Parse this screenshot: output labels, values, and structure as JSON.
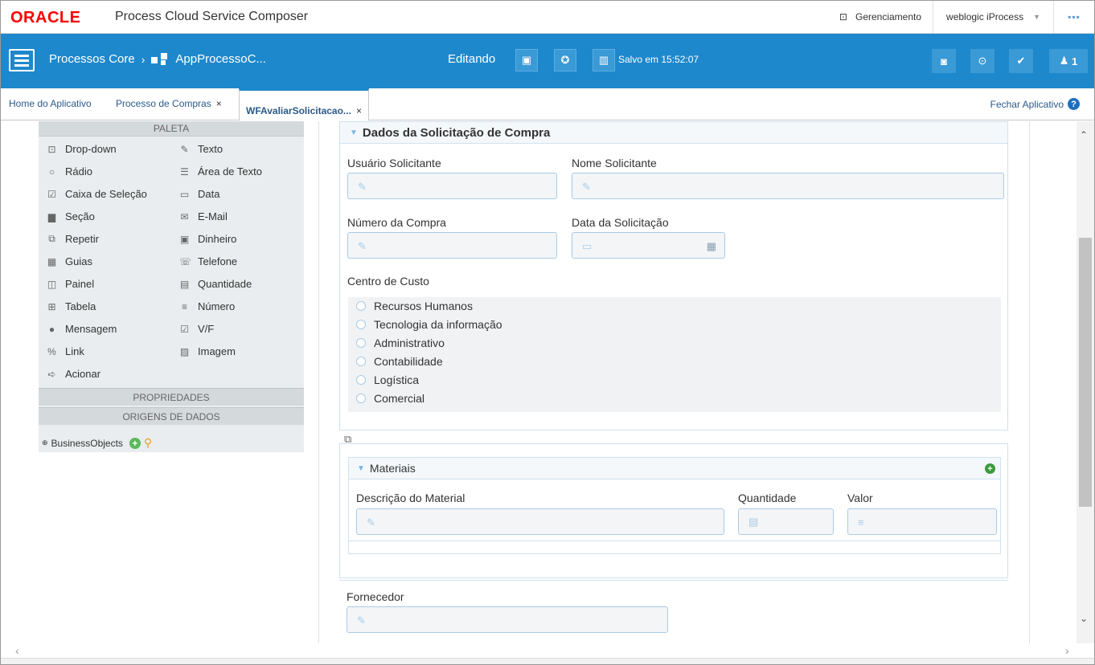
{
  "header": {
    "logo": "ORACLE",
    "app_name": "Process Cloud Service Composer",
    "management": "Gerenciamento",
    "user": "weblogic iProcess",
    "more": "..."
  },
  "toolbar": {
    "project": "Processos Core",
    "separator": "›",
    "app": "AppProcessoC...",
    "mode": "Editando",
    "saved": "Salvo em 15:52:07",
    "user_count": "1"
  },
  "tabs": [
    {
      "label": "Home do Aplicativo"
    },
    {
      "label": "Processo de Compras",
      "close": "×"
    },
    {
      "label": "WFAvaliarSolicitacao...",
      "close": "×"
    }
  ],
  "close_app": "Fechar Aplicativo",
  "palette": {
    "title": "PALETA",
    "left": [
      {
        "label": "Drop-down",
        "icon": "dropdown-icon"
      },
      {
        "label": "Rádio",
        "icon": "radio-icon"
      },
      {
        "label": "Caixa de Seleção",
        "icon": "checkbox-icon"
      },
      {
        "label": "Seção",
        "icon": "folder-icon"
      },
      {
        "label": "Repetir",
        "icon": "repeat-icon"
      },
      {
        "label": "Guias",
        "icon": "tabs-icon"
      },
      {
        "label": "Painel",
        "icon": "panel-icon"
      },
      {
        "label": "Tabela",
        "icon": "table-icon"
      },
      {
        "label": "Mensagem",
        "icon": "message-icon"
      },
      {
        "label": "Link",
        "icon": "link-icon"
      },
      {
        "label": "Acionar",
        "icon": "action-icon"
      }
    ],
    "right": [
      {
        "label": "Texto",
        "icon": "pencil-icon"
      },
      {
        "label": "Área de Texto",
        "icon": "textarea-icon"
      },
      {
        "label": "Data",
        "icon": "calendar-icon"
      },
      {
        "label": "E-Mail",
        "icon": "email-icon"
      },
      {
        "label": "Dinheiro",
        "icon": "money-icon"
      },
      {
        "label": "Telefone",
        "icon": "phone-icon"
      },
      {
        "label": "Quantidade",
        "icon": "keyboard-icon"
      },
      {
        "label": "Número",
        "icon": "list-number-icon"
      },
      {
        "label": "V/F",
        "icon": "checkbox-icon"
      },
      {
        "label": "Imagem",
        "icon": "image-icon"
      }
    ],
    "properties": "PROPRIEDADES",
    "data_sources": "ORIGENS DE DADOS",
    "business_objects": "BusinessObjects"
  },
  "form": {
    "section_title": "Dados da Solicitação de Compra",
    "usuario": "Usuário Solicitante",
    "nome": "Nome Solicitante",
    "numero": "Número da Compra",
    "data": "Data da Solicitação",
    "centro": "Centro de Custo",
    "options": [
      "Recursos Humanos",
      "Tecnologia da informação",
      "Administrativo",
      "Contabilidade",
      "Logística",
      "Comercial"
    ],
    "materiais": "Materiais",
    "descricao": "Descrição do Material",
    "quantidade": "Quantidade",
    "valor": "Valor",
    "fornecedor": "Fornecedor"
  }
}
